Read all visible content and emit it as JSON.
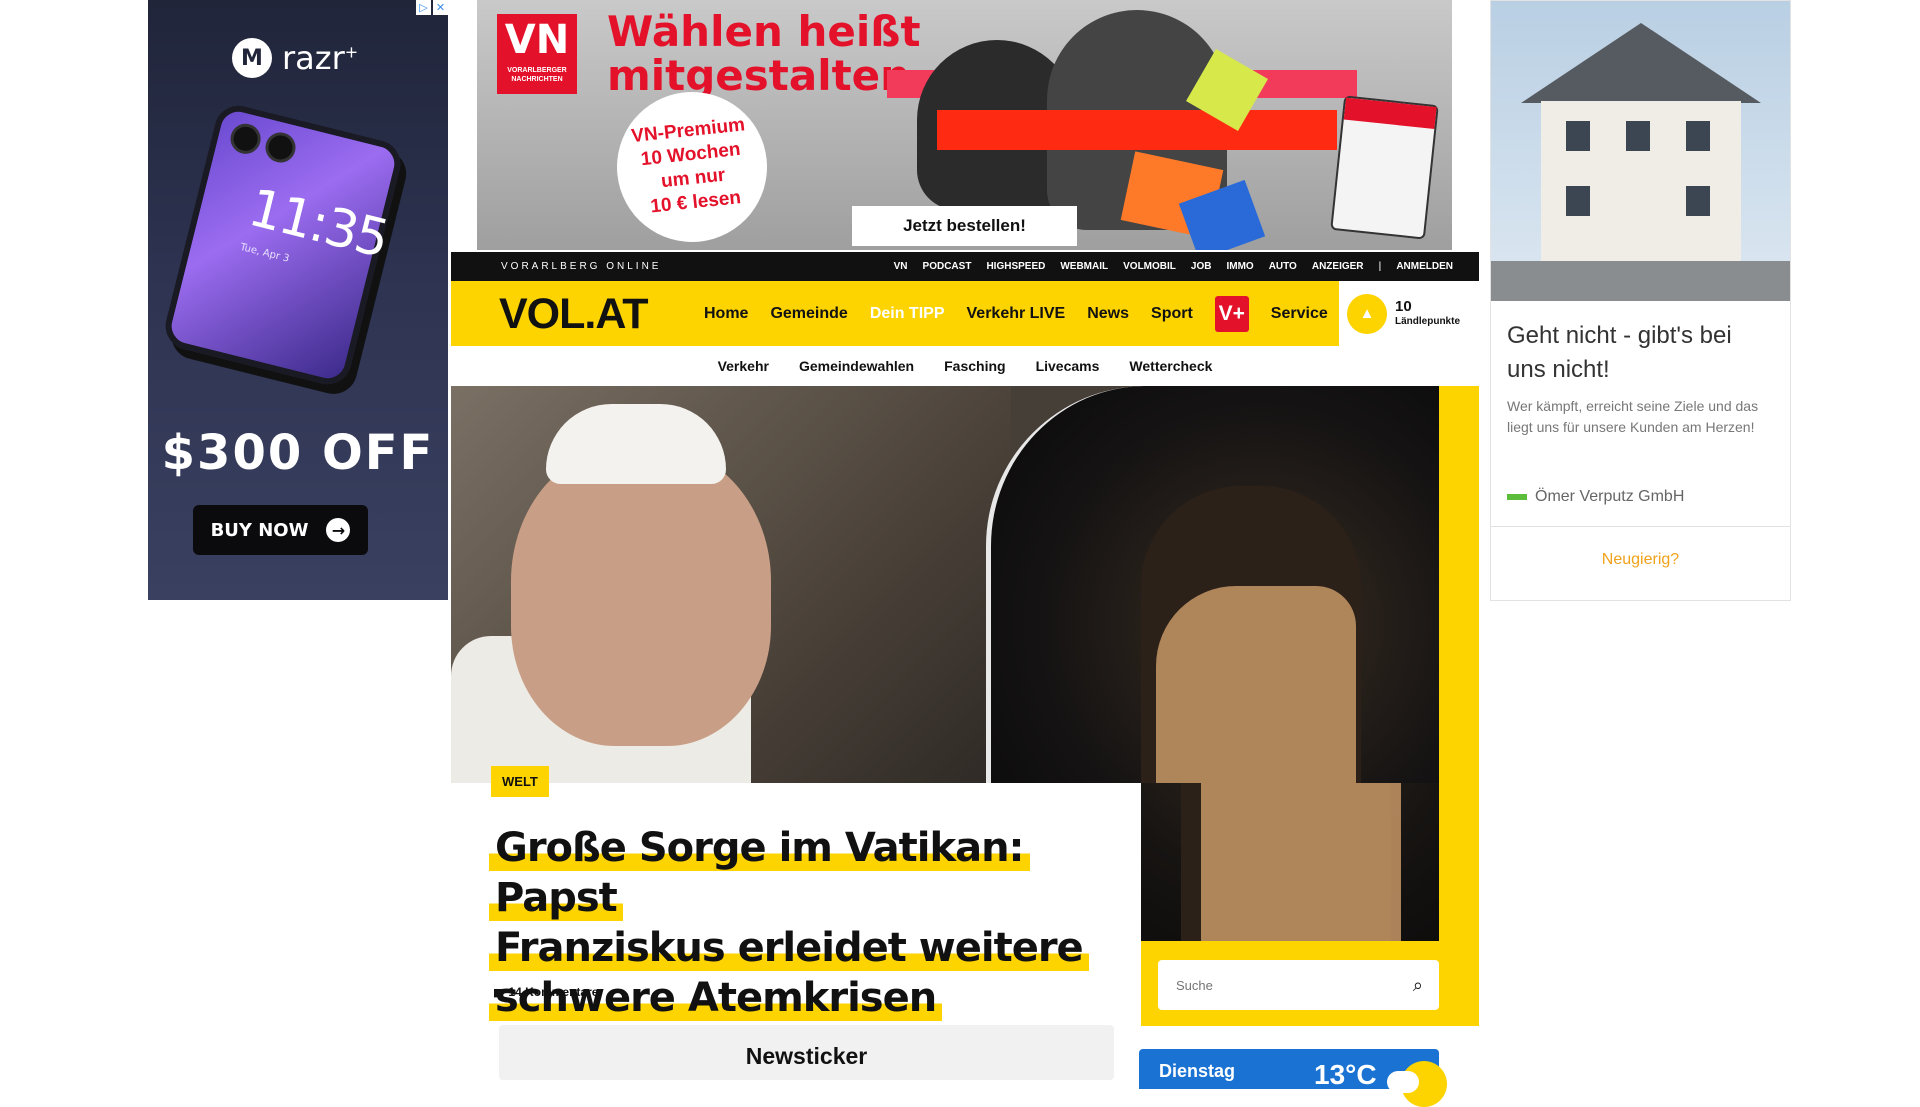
{
  "colors": {
    "brand_yellow": "#fdd300",
    "top_bar": "#111111",
    "vplus_red": "#e4112a",
    "weather_blue": "#1a73d3",
    "ad_link": "#f0a21b"
  },
  "left_ad": {
    "brand": "razr",
    "brand_sup": "+",
    "phone_time": "11:35",
    "phone_date": "Tue, Apr 3",
    "offer": "$300 OFF",
    "cta": "BUY NOW",
    "adchoices_icons": [
      "adchoices-icon",
      "close-icon"
    ]
  },
  "top_banner": {
    "logo_text": "VN",
    "logo_sub": "VORARLBERGER NACHRICHTEN",
    "headline_line1": "Wählen heißt",
    "headline_line2": "mitgestalten",
    "offer_line1": "VN-Premium",
    "offer_line2": "10 Wochen",
    "offer_line3": "um nur",
    "offer_line4": "10 € lesen",
    "cta": "Jetzt bestellen!"
  },
  "top_bar": {
    "site_label": "VORARLBERG ONLINE",
    "links": [
      "VN",
      "PODCAST",
      "HIGHSPEED",
      "WEBMAIL",
      "VOLMOBIL",
      "JOB",
      "IMMO",
      "AUTO",
      "ANZEIGER"
    ],
    "separator": "|",
    "login": "ANMELDEN"
  },
  "main_nav": {
    "logo": "VOL.AT",
    "items": [
      "Home",
      "Gemeinde",
      "Dein TIPP",
      "Verkehr LIVE",
      "News",
      "Sport"
    ],
    "vplus": "V+",
    "service": "Service",
    "points_value": "10",
    "points_label": "Ländlepunkte"
  },
  "sub_nav": [
    "Verkehr",
    "Gemeindewahlen",
    "Fasching",
    "Livecams",
    "Wettercheck"
  ],
  "article": {
    "category": "WELT",
    "headline_line1": "Große Sorge im Vatikan: Papst",
    "headline_line2": "Franziskus erleidet weitere",
    "headline_line3": "schwere Atemkrisen",
    "comments": "14 Kommentare",
    "newsticker": "Newsticker"
  },
  "sidebar": {
    "search_placeholder": "Suche",
    "weather_day": "Dienstag",
    "weather_temp": "13°C"
  },
  "right_ad": {
    "title": "Geht nicht - gibt's bei uns nicht!",
    "description": "Wer kämpft, erreicht seine Ziele und das liegt uns für unsere Kunden am Herzen!",
    "sponsor": "Ömer Verputz GmbH",
    "cta": "Neugierig?"
  }
}
